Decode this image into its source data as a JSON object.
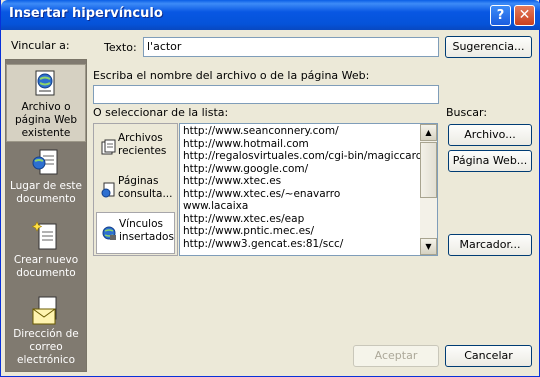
{
  "window": {
    "title": "Insertar hipervínculo",
    "help_glyph": "?",
    "close_glyph": "✕"
  },
  "left": {
    "label": "Vincular a:",
    "items": [
      {
        "label": "Archivo o página Web existente",
        "icon": "web-page-icon",
        "selected": true
      },
      {
        "label": "Lugar de este documento",
        "icon": "document-place-icon",
        "selected": false
      },
      {
        "label": "Crear nuevo documento",
        "icon": "new-document-icon",
        "selected": false
      },
      {
        "label": "Dirección de correo electrónico",
        "icon": "email-icon",
        "selected": false
      }
    ]
  },
  "texto": {
    "label": "Texto:",
    "value": "l'actor"
  },
  "sugerencia_label": "Sugerencia...",
  "filename": {
    "label": "Escriba el nombre del archivo o de la página Web:",
    "value": ""
  },
  "select_list_label": "O seleccionar de la lista:",
  "buscar": {
    "label": "Buscar:",
    "archivo": "Archivo...",
    "pagina_web": "Página Web..."
  },
  "list_categories": [
    {
      "label": "Archivos recientes",
      "icon": "recent-files-icon",
      "selected": false
    },
    {
      "label": "Páginas consulta...",
      "icon": "browsed-pages-icon",
      "selected": false
    },
    {
      "label": "Vínculos insertados",
      "icon": "inserted-links-icon",
      "selected": true
    }
  ],
  "urls": [
    "http://www.seanconnery.com/",
    "http://www.hotmail.com",
    "http://regalosvirtuales.com/cgi-bin/magiccard.cgi?",
    "http://www.google.com/",
    "http://www.xtec.es",
    "http://www.xtec.es/~enavarro",
    "www.lacaixa",
    "http://www.xtec.es/eap",
    "http://www.pntic.mec.es/",
    "http://www3.gencat.es:81/scc/"
  ],
  "marcador_label": "Marcador...",
  "aceptar_label": "Aceptar",
  "cancelar_label": "Cancelar",
  "scroll_arrows": {
    "up": "▲",
    "down": "▼"
  }
}
